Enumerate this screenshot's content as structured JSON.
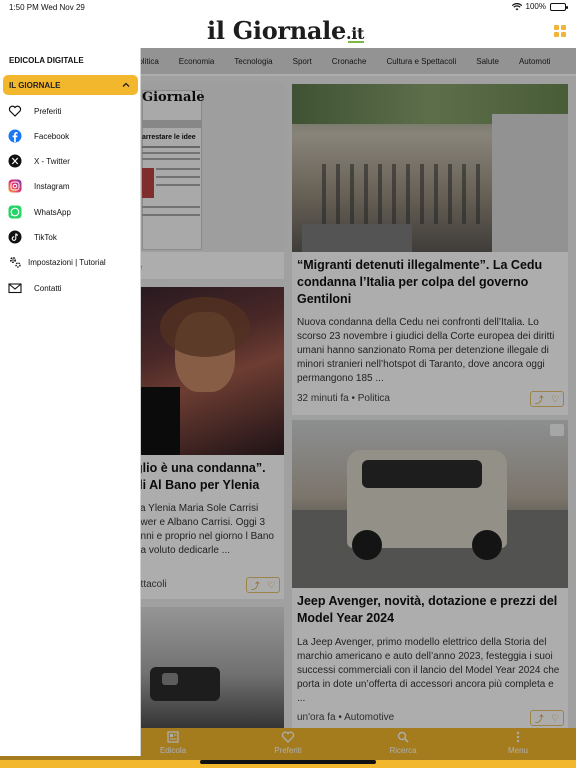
{
  "status": {
    "time": "1:50 PM",
    "date": "Wed Nov 29",
    "battery": "100%"
  },
  "brand": {
    "name": "il Giornale",
    "tld": ".it",
    "accent": "#f2b72d"
  },
  "categories": [
    "Politica",
    "Economia",
    "Tecnologia",
    "Sport",
    "Cronache",
    "Cultura e Spettacoli",
    "Salute",
    "Automoti"
  ],
  "cards": {
    "edicola": {
      "caption": "e"
    },
    "migranti": {
      "title": "“Migranti detenuti illegalmente”. La Cedu condanna l’Italia per colpa del governo Gentiloni",
      "text": "Nuova condanna della Cedu nei confronti dell’Italia. Lo scorso 23 novembre i giudici della Corte europea dei diritti umani hanno sanzionato Roma per detenzione illegale di minori stranieri nell’hotspot di Taranto, dove ancora oggi permangono 185 ...",
      "meta": "32 minuti fa • Politica"
    },
    "ylenia": {
      "title": "glio è una condanna”. di Al Bano per Ylenia",
      "text": "va Ylenia Maria Sole Carrisi ower e Albano Carrisi. Oggi 3 anni e proprio nel giorno l Bano ha voluto dedicarle ...",
      "meta": "ettacoli"
    },
    "avenger": {
      "title": "Jeep Avenger, novità, dotazione e prezzi del Model Year 2024",
      "text": "La Jeep Avenger, primo modello elettrico della Storia del marchio americano e auto dell’anno 2023, festeggia i suoi successi commerciali con il lancio del Model Year 2024 che porta in dote un’offerta di accessori ancora più completa e ...",
      "meta": "un'ora fa • Automotive"
    }
  },
  "newspaper": {
    "masthead": "Giornale",
    "headline": "arrestare le idee"
  },
  "tabbar": [
    {
      "label": "Edicola",
      "icon": "newspaper-icon"
    },
    {
      "label": "Preferiti",
      "icon": "heart-icon"
    },
    {
      "label": "Ricerca",
      "icon": "search-icon"
    },
    {
      "label": "Menu",
      "icon": "more-icon"
    }
  ],
  "drawer": {
    "header": "EDICOLA DIGITALE",
    "section": "IL GIORNALE",
    "items": [
      {
        "label": "Preferiti",
        "icon": "heart-icon"
      },
      {
        "label": "Facebook",
        "icon": "facebook-icon"
      },
      {
        "label": "X - Twitter",
        "icon": "x-twitter-icon"
      },
      {
        "label": "Instagram",
        "icon": "instagram-icon"
      },
      {
        "label": "WhatsApp",
        "icon": "whatsapp-icon"
      },
      {
        "label": "TikTok",
        "icon": "tiktok-icon"
      },
      {
        "label": "Impostazioni | Tutorial",
        "icon": "settings-icon"
      },
      {
        "label": "Contatti",
        "icon": "mail-icon"
      }
    ]
  }
}
